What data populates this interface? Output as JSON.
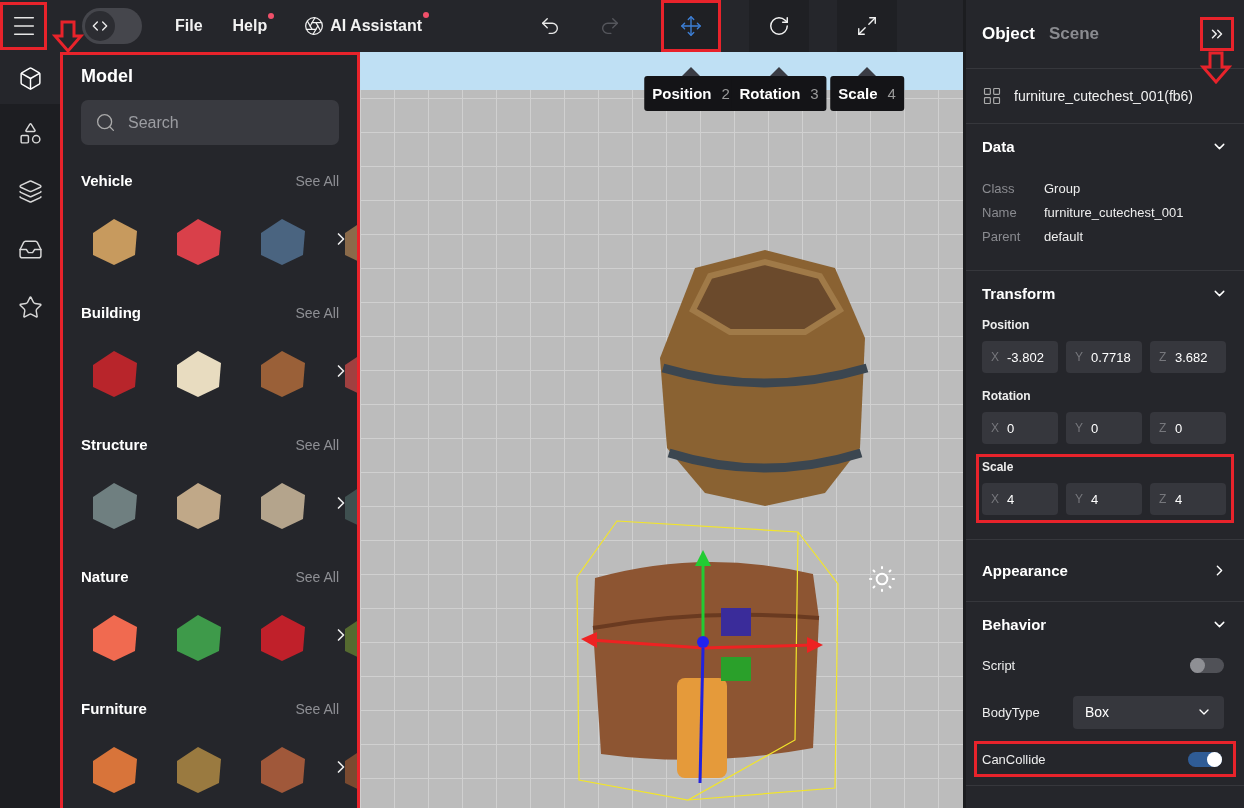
{
  "top_bar": {
    "menu_button": {
      "highlighted": true,
      "arrow": true
    },
    "code_toggle": {
      "on": false
    },
    "menus": [
      {
        "label": "File",
        "badge": false,
        "kind": "plain"
      },
      {
        "label": "Help",
        "badge": true,
        "kind": "plain"
      },
      {
        "label": "AI Assistant",
        "badge": true,
        "kind": "assistant"
      }
    ],
    "history": [
      {
        "kind": "undo",
        "disabled": false
      },
      {
        "kind": "redo",
        "disabled": true
      }
    ],
    "tools": [
      {
        "kind": "move",
        "selected": true,
        "highlighted": true,
        "tooltip": "Position",
        "shortcut": "2"
      },
      {
        "kind": "rotate",
        "selected": false,
        "highlighted": false,
        "tooltip": "Rotation",
        "shortcut": "3"
      },
      {
        "kind": "scale",
        "selected": false,
        "highlighted": false,
        "tooltip": "Scale",
        "shortcut": "4"
      }
    ]
  },
  "rail": [
    {
      "kind": "model",
      "selected": true
    },
    {
      "kind": "shapes",
      "selected": false
    },
    {
      "kind": "layers",
      "selected": false
    },
    {
      "kind": "inbox",
      "selected": false
    },
    {
      "kind": "star",
      "selected": false
    }
  ],
  "library": {
    "title": "Model",
    "highlighted": true,
    "search": {
      "placeholder": "Search"
    },
    "categories": [
      {
        "name": "Vehicle",
        "link": "See All",
        "items": [
          {
            "color": "#c79a5e"
          },
          {
            "color": "#d9404a"
          },
          {
            "color": "#4a6480"
          },
          {
            "color": "#8a6a4a"
          }
        ]
      },
      {
        "name": "Building",
        "link": "See All",
        "items": [
          {
            "color": "#b8252b"
          },
          {
            "color": "#e8dcc0"
          },
          {
            "color": "#9a6038"
          },
          {
            "color": "#a04040"
          }
        ]
      },
      {
        "name": "Structure",
        "link": "See All",
        "items": [
          {
            "color": "#6f7f80"
          },
          {
            "color": "#c0a888"
          },
          {
            "color": "#b4a48c"
          },
          {
            "color": "#3f5050"
          }
        ]
      },
      {
        "name": "Nature",
        "link": "See All",
        "items": [
          {
            "color": "#f06a50"
          },
          {
            "color": "#3e9a4a"
          },
          {
            "color": "#c0202a"
          },
          {
            "color": "#556a30"
          }
        ]
      },
      {
        "name": "Furniture",
        "link": "See All",
        "items": [
          {
            "color": "#d8743a"
          },
          {
            "color": "#9a7a40"
          },
          {
            "color": "#a0583a"
          },
          {
            "color": "#7a4a30"
          }
        ]
      }
    ]
  },
  "viewport": {
    "light_button": {
      "selected": false
    }
  },
  "inspector": {
    "tabs": [
      {
        "label": "Object",
        "selected": true
      },
      {
        "label": "Scene",
        "selected": false
      }
    ],
    "collapse_button": {
      "highlighted": true,
      "arrow": true
    },
    "object_name": "furniture_cutechest_001(fb6)",
    "sections": [
      {
        "title": "Data",
        "expanded": true,
        "fields": [
          {
            "label": "Class",
            "value": "Group"
          },
          {
            "label": "Name",
            "value": "furniture_cutechest_001"
          },
          {
            "label": "Parent",
            "value": "default"
          }
        ]
      },
      {
        "title": "Transform",
        "expanded": true,
        "groups": [
          {
            "label": "Position",
            "highlighted": false,
            "axes": [
              {
                "axis": "X",
                "value": "-3.802"
              },
              {
                "axis": "Y",
                "value": "0.7718"
              },
              {
                "axis": "Z",
                "value": "3.682"
              }
            ]
          },
          {
            "label": "Rotation",
            "highlighted": false,
            "axes": [
              {
                "axis": "X",
                "value": "0"
              },
              {
                "axis": "Y",
                "value": "0"
              },
              {
                "axis": "Z",
                "value": "0"
              }
            ]
          },
          {
            "label": "Scale",
            "highlighted": true,
            "axes": [
              {
                "axis": "X",
                "value": "4"
              },
              {
                "axis": "Y",
                "value": "4"
              },
              {
                "axis": "Z",
                "value": "4"
              }
            ]
          }
        ]
      },
      {
        "title": "Appearance",
        "expanded": false
      },
      {
        "title": "Behavior",
        "expanded": true,
        "props": [
          {
            "kind": "toggle",
            "label": "Script",
            "on": false,
            "highlighted": false
          },
          {
            "kind": "select",
            "label": "BodyType",
            "value": "Box",
            "highlighted": false
          },
          {
            "kind": "toggle",
            "label": "CanCollide",
            "on": true,
            "highlighted": true
          }
        ]
      }
    ]
  }
}
